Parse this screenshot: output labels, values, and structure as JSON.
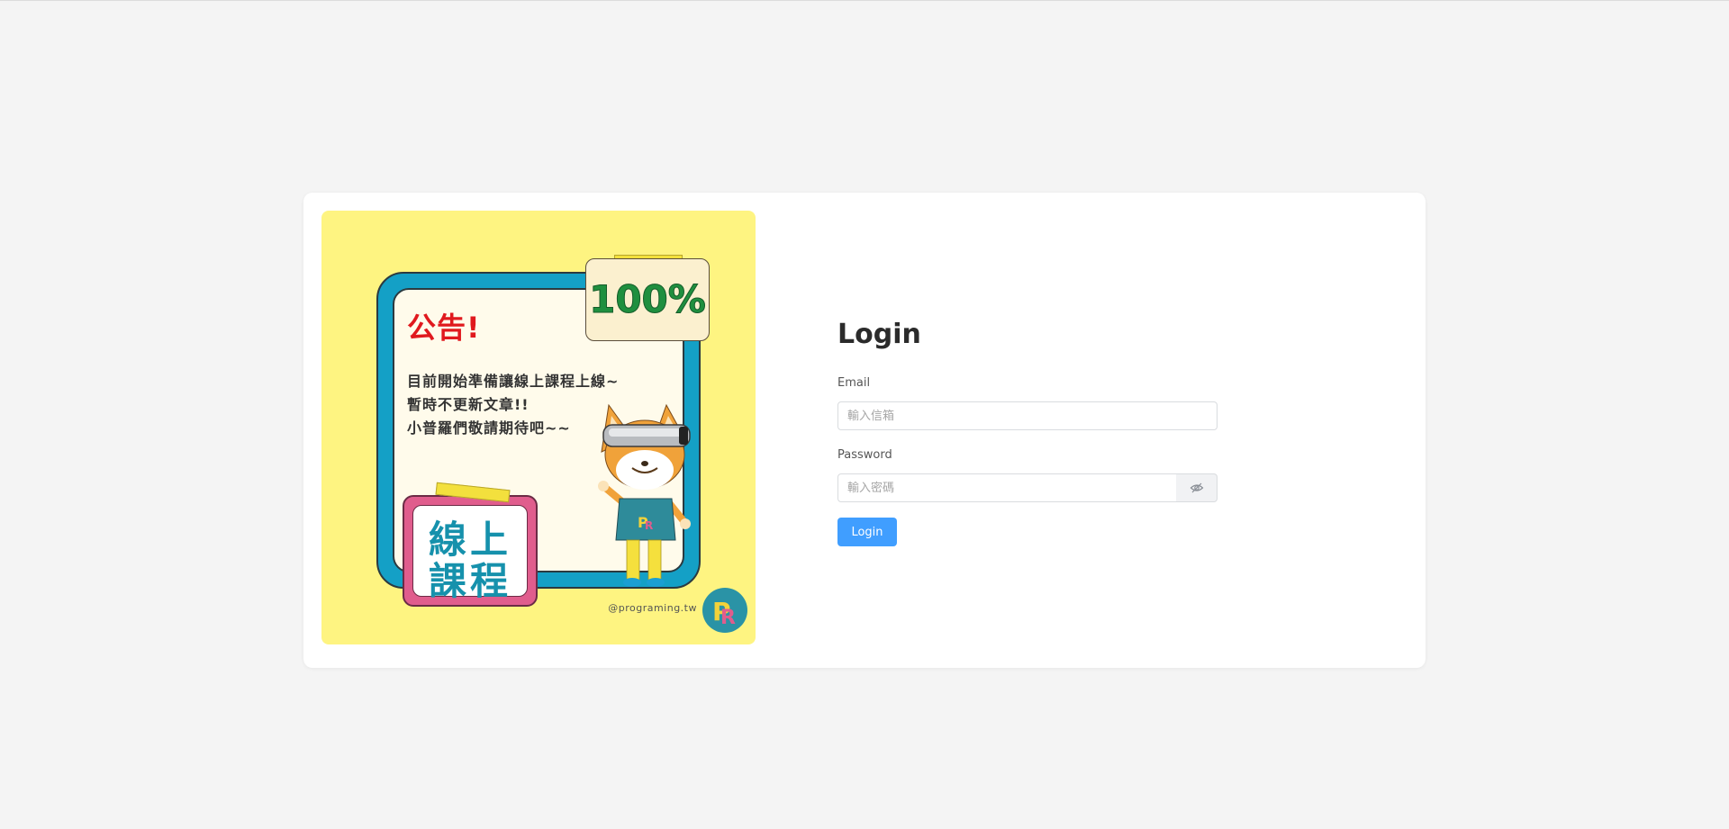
{
  "promo": {
    "announce_title": "公告!",
    "announce_lines": [
      "目前開始準備讓線上課程上線~",
      "暫時不更新文章!!",
      "小普羅們敬請期待吧~~"
    ],
    "percent": "100%",
    "course_lines": [
      "線上",
      "課程"
    ],
    "handle": "@programing.tw",
    "colors": {
      "background": "#fef481",
      "board_border": "#14a0c6",
      "announce_red": "#e0191e",
      "percent_green": "#1f8f3f",
      "course_pink": "#e05d8d",
      "course_text": "#1691ac"
    }
  },
  "login": {
    "title": "Login",
    "email": {
      "label": "Email",
      "placeholder": "輸入信箱",
      "value": ""
    },
    "password": {
      "label": "Password",
      "placeholder": "輸入密碼",
      "value": "",
      "toggle_icon": "eye-off-icon"
    },
    "submit_label": "Login",
    "accent": "#409eff"
  }
}
